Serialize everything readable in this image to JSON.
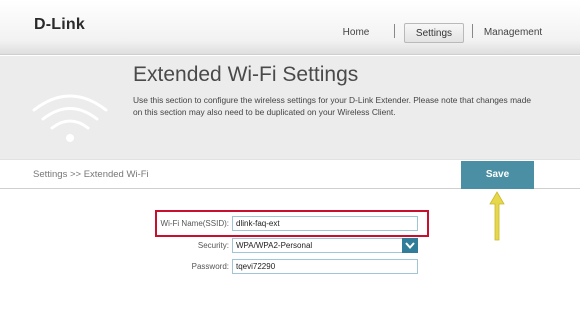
{
  "brand": {
    "logo": "D-Link"
  },
  "nav": {
    "home": "Home",
    "settings": "Settings",
    "management": "Management"
  },
  "header": {
    "title": "Extended Wi-Fi Settings",
    "description": "Use this section to configure the wireless settings for your D-Link Extender. Please note that changes made on this section may also need to be duplicated on your Wireless Client."
  },
  "breadcrumb": "Settings >> Extended Wi-Fi",
  "toolbar": {
    "save_label": "Save"
  },
  "form": {
    "ssid": {
      "label": "Wi-Fi Name(SSID):",
      "value": "dlink-faq-ext"
    },
    "security": {
      "label": "Security:",
      "value": "WPA/WPA2-Personal"
    },
    "password": {
      "label": "Password:",
      "value": "tqevi72290"
    }
  },
  "colors": {
    "accent": "#4a8fa3",
    "select_button": "#2f7d98",
    "highlight_box": "#c8102e",
    "annotation_arrow": "#e6d84a"
  },
  "icons": [
    "wifi-icon",
    "chevron-down-icon",
    "up-arrow-icon"
  ]
}
